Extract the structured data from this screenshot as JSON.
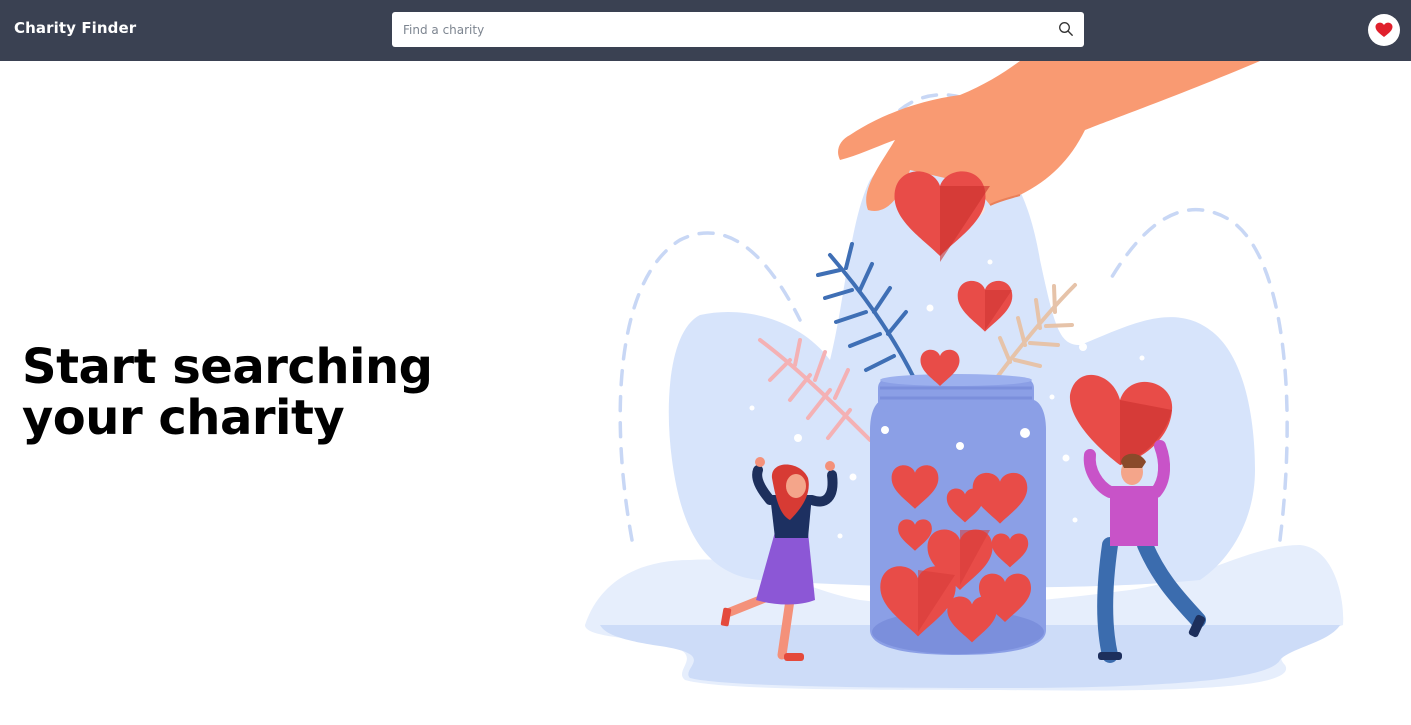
{
  "header": {
    "brand": "Charity Finder",
    "search_placeholder": "Find a charity",
    "search_icon": "search-icon",
    "favorites_icon": "heart-icon"
  },
  "hero": {
    "title_line1": "Start searching",
    "title_line2": "your charity"
  },
  "colors": {
    "header_bg": "#3a4152",
    "heart_red": "#e84c48",
    "jar_blue": "#8b9fe6",
    "backdrop_blue": "#d7e4fb"
  }
}
